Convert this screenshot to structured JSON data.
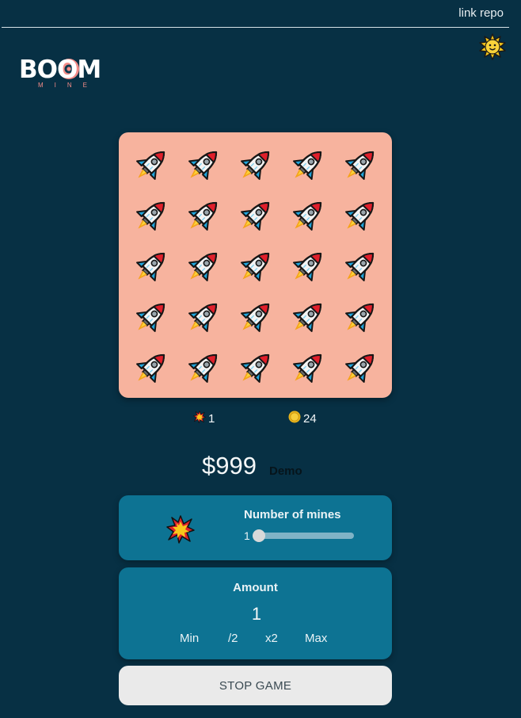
{
  "header": {
    "link_label": "link repo",
    "theme_icon": "sun-icon"
  },
  "logo": {
    "word": "BOOM",
    "sub": "MINE"
  },
  "board": {
    "rows": 5,
    "cols": 5,
    "tile_icon": "rocket-icon",
    "background": "#f7b39e"
  },
  "stats": {
    "mines_icon": "explosion-icon",
    "mines_count": "1",
    "coins_icon": "coin-icon",
    "coins_count": "24"
  },
  "balance": {
    "amount": "$999",
    "mode": "Demo"
  },
  "mines_panel": {
    "title": "Number of mines",
    "value": "1",
    "icon": "explosion-icon"
  },
  "amount_panel": {
    "title": "Amount",
    "value": "1",
    "buttons": {
      "min": "Min",
      "half": "/2",
      "double": "x2",
      "max": "Max"
    }
  },
  "stop_button": "STOP GAME",
  "colors": {
    "background": "#073044",
    "panel": "#0d7393",
    "board": "#f7b39e",
    "button": "#eaeaea"
  }
}
